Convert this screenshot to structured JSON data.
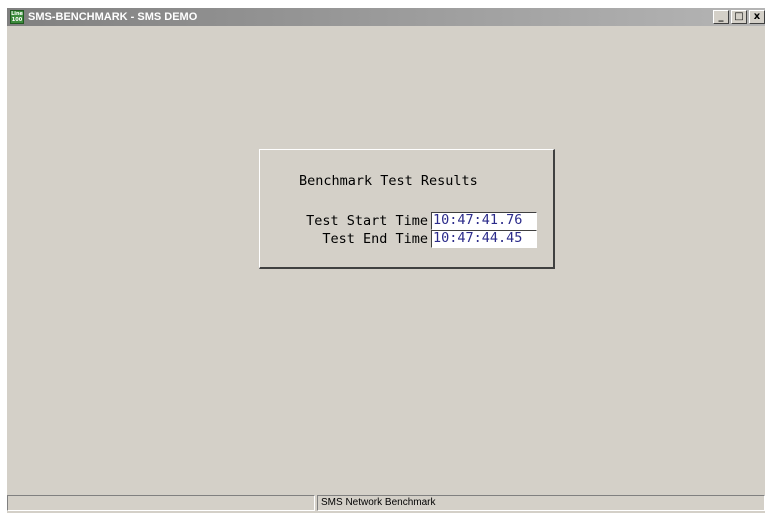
{
  "window": {
    "title": "SMS-BENCHMARK - SMS DEMO",
    "icon": {
      "name": "line-100-app-icon",
      "line1": "Line",
      "line2": "100"
    },
    "controls": {
      "minimize": "_",
      "maximize": "□",
      "close": "x"
    }
  },
  "dialog": {
    "title": "Benchmark Test Results",
    "start_label": "Test Start Time",
    "start_value": "10:47:41.76",
    "end_label": "Test End Time",
    "end_value": "10:47:44.45"
  },
  "statusbar": {
    "pane1": "",
    "pane2": "SMS Network Benchmark"
  },
  "colors": {
    "window_background": "#d4d0c8",
    "titlebar_inactive": "#808080",
    "field_text": "#2b2b8a",
    "app_icon": "#3c8c3c"
  }
}
